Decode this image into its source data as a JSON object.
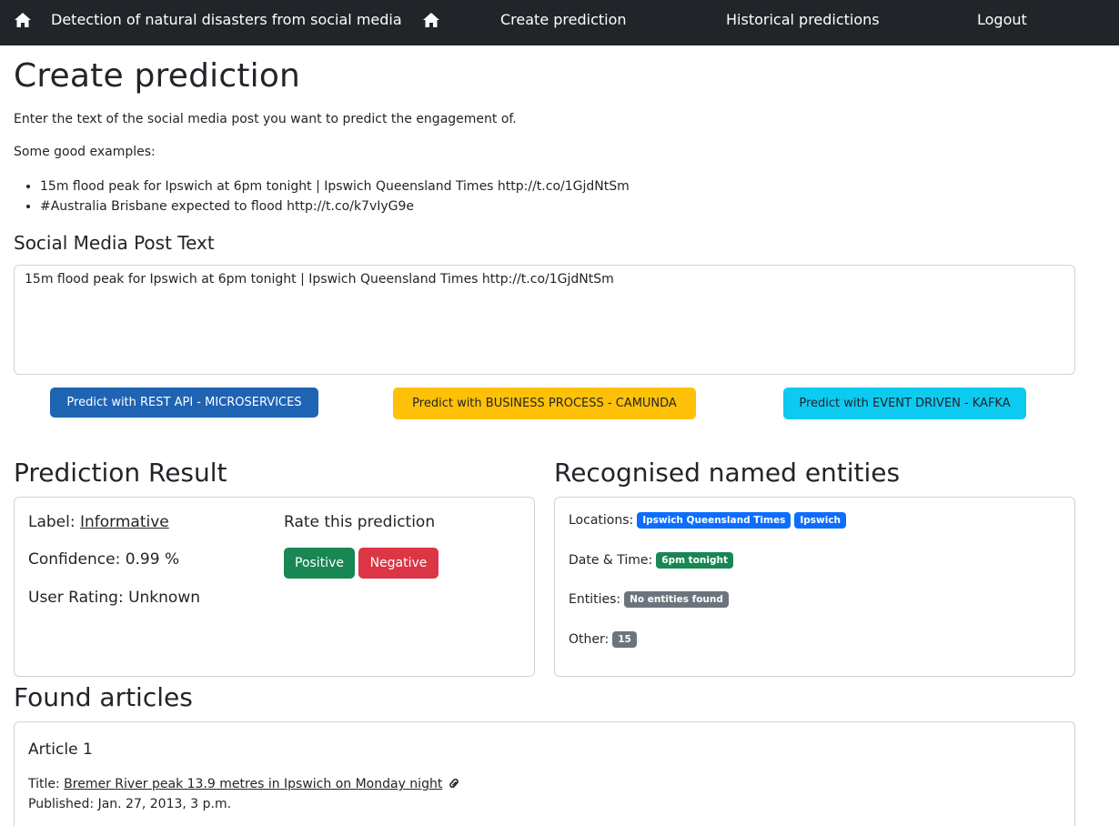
{
  "nav": {
    "brand": "Detection of natural disasters from social media",
    "links": [
      "Create prediction",
      "Historical predictions",
      "Logout"
    ]
  },
  "page": {
    "title": "Create prediction",
    "intro": "Enter the text of the social media post you want to predict the engagement of.",
    "examples_heading": "Some good examples:",
    "examples": [
      "15m flood peak for Ipswich at 6pm tonight | Ipswich Queensland Times http://t.co/1GjdNtSm",
      "#Australia Brisbane expected to flood http://t.co/k7vIyG9e"
    ]
  },
  "post": {
    "label": "Social Media Post Text",
    "value": "15m flood peak for Ipswich at 6pm tonight | Ipswich Queensland Times http://t.co/1GjdNtSm"
  },
  "buttons": {
    "rest": "Predict with REST API - MICROSERVICES",
    "camunda": "Predict with BUSINESS PROCESS - CAMUNDA",
    "kafka": "Predict with EVENT DRIVEN - KAFKA"
  },
  "result": {
    "heading": "Prediction Result",
    "label_prefix": "Label: ",
    "label_value": "Informative",
    "confidence": "Confidence: 0.99 %",
    "user_rating": "User Rating: Unknown",
    "rate_heading": "Rate this prediction",
    "positive": "Positive",
    "negative": "Negative"
  },
  "entities": {
    "heading": "Recognised named entities",
    "locations_label": "Locations:",
    "locations": [
      "Ipswich Queensland Times",
      "Ipswich"
    ],
    "datetime_label": "Date & Time:",
    "datetime": [
      "6pm tonight"
    ],
    "entities_label": "Entities:",
    "entities_value": "No entities found",
    "other_label": "Other:",
    "other": [
      "15"
    ]
  },
  "articles": {
    "heading": "Found articles",
    "items": [
      {
        "name": "Article 1",
        "title_prefix": "Title: ",
        "title": "Bremer River peak 13.9 metres in Ipswich on Monday night",
        "published": "Published: Jan. 27, 2013, 3 p.m."
      }
    ]
  },
  "colors": {
    "navbar": "#212529",
    "primary": "#1f63b3",
    "warning": "#ffc107",
    "info": "#0dcaf0",
    "success": "#198754",
    "danger": "#dc3545",
    "badge_blue": "#0d6efd",
    "badge_grey": "#6c757d"
  },
  "icons": {
    "home": "home-icon",
    "link": "link-icon"
  }
}
